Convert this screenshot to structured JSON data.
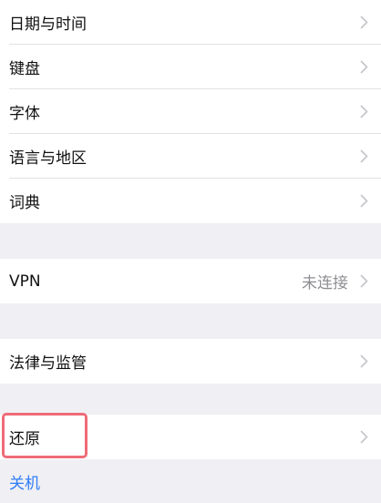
{
  "group1": {
    "items": [
      {
        "label": "日期与时间"
      },
      {
        "label": "键盘"
      },
      {
        "label": "字体"
      },
      {
        "label": "语言与地区"
      },
      {
        "label": "词典"
      }
    ]
  },
  "group2": {
    "items": [
      {
        "label": "VPN",
        "value": "未连接"
      }
    ]
  },
  "group3": {
    "items": [
      {
        "label": "法律与监管"
      }
    ]
  },
  "group4": {
    "items": [
      {
        "label": "还原"
      }
    ]
  },
  "shutdown": {
    "label": "关机"
  },
  "colors": {
    "background": "#efeff4",
    "highlight": "#ef6b78",
    "link": "#2f7df6",
    "chevron": "#c7c7cc"
  }
}
